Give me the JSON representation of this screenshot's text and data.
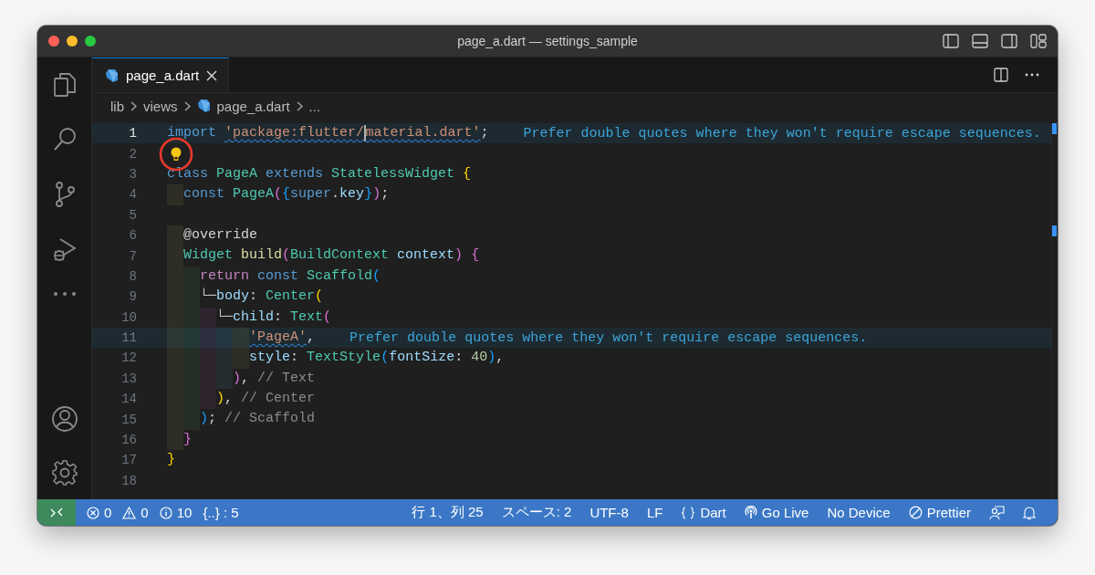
{
  "window": {
    "title": "page_a.dart — settings_sample"
  },
  "tabs": [
    {
      "label": "page_a.dart",
      "selected": true
    }
  ],
  "breadcrumbs": [
    {
      "label": "lib",
      "kind": "folder"
    },
    {
      "label": "views",
      "kind": "folder"
    },
    {
      "label": "page_a.dart",
      "kind": "file"
    },
    {
      "label": "...",
      "kind": "folder"
    }
  ],
  "editor": {
    "lines": [
      {
        "number": "1",
        "current": true,
        "diagnostic": "Prefer double quotes where they won't require escape sequences.",
        "tokens": [
          {
            "t": "import ",
            "color": "#569cd6"
          },
          {
            "t": "'package:flutter/",
            "color": "#ce9178",
            "squiggle": true,
            "cursor_after": true
          },
          {
            "t": "material.dart'",
            "color": "#ce9178",
            "squiggle": true
          },
          {
            "t": ";"
          }
        ]
      },
      {
        "number": "2",
        "current": false,
        "lightbulb": true
      },
      {
        "number": "3",
        "current": false,
        "tokens": [
          {
            "t": "class ",
            "color": "#569cd6"
          },
          {
            "t": "PageA ",
            "color": "#4ec9b0"
          },
          {
            "t": "extends ",
            "color": "#569cd6"
          },
          {
            "t": "StatelessWidget ",
            "color": "#4ec9b0"
          },
          {
            "t": "{",
            "color": "#ffd700"
          }
        ]
      },
      {
        "number": "4",
        "current": false,
        "tokens": [
          {
            "t": "  const ",
            "color": "#569cd6"
          },
          {
            "t": "PageA",
            "color": "#4ec9b0"
          },
          {
            "t": "(",
            "color": "#da70d6"
          },
          {
            "t": "{",
            "color": "#179fff"
          },
          {
            "t": "super",
            "color": "#569cd6"
          },
          {
            "t": "."
          },
          {
            "t": "key",
            "color": "#9cdcfe"
          },
          {
            "t": "}",
            "color": "#179fff"
          },
          {
            "t": ")",
            "color": "#da70d6"
          },
          {
            "t": ";",
            "color": "#d4d4d4"
          }
        ]
      },
      {
        "number": "5",
        "current": false
      },
      {
        "number": "6",
        "current": false,
        "tokens": [
          {
            "t": "  @override",
            "color": "#d4d4d4"
          }
        ]
      },
      {
        "number": "7",
        "current": false,
        "tokens": [
          {
            "t": "  Widget ",
            "color": "#4ec9b0"
          },
          {
            "t": "build",
            "color": "#dcdcaa"
          },
          {
            "t": "(",
            "color": "#da70d6"
          },
          {
            "t": "BuildContext ",
            "color": "#4ec9b0"
          },
          {
            "t": "context",
            "color": "#9cdcfe"
          },
          {
            "t": ") ",
            "color": "#da70d6"
          },
          {
            "t": "{",
            "color": "#da70d6"
          }
        ]
      },
      {
        "number": "8",
        "current": false,
        "tokens": [
          {
            "t": "    return ",
            "color": "#c586c0"
          },
          {
            "t": "const ",
            "color": "#569cd6"
          },
          {
            "t": "Scaffold",
            "color": "#4ec9b0"
          },
          {
            "t": "(",
            "color": "#179fff"
          }
        ]
      },
      {
        "number": "9",
        "current": false,
        "tokens": [
          {
            "t": "    └─",
            "color": "#c8c8c8"
          },
          {
            "t": "body",
            "color": "#9cdcfe"
          },
          {
            "t": ": ",
            "color": "#d4d4d4"
          },
          {
            "t": "Center",
            "color": "#4ec9b0"
          },
          {
            "t": "(",
            "color": "#ffd700"
          }
        ]
      },
      {
        "number": "10",
        "current": false,
        "tokens": [
          {
            "t": "      └─",
            "color": "#c8c8c8"
          },
          {
            "t": "child",
            "color": "#9cdcfe"
          },
          {
            "t": ": ",
            "color": "#d4d4d4"
          },
          {
            "t": "Text",
            "color": "#4ec9b0"
          },
          {
            "t": "(",
            "color": "#da70d6"
          }
        ]
      },
      {
        "number": "11",
        "current": false,
        "diagnostic": "Prefer double quotes where they won't require escape sequences.",
        "tokens": [
          {
            "t": "          'PageA'",
            "color": "#ce9178",
            "squiggle": true
          },
          {
            "t": ",",
            "color": "#d4d4d4"
          }
        ]
      },
      {
        "number": "12",
        "current": false,
        "tokens": [
          {
            "t": "          style",
            "color": "#9cdcfe"
          },
          {
            "t": ": ",
            "color": "#d4d4d4"
          },
          {
            "t": "TextStyle",
            "color": "#4ec9b0"
          },
          {
            "t": "(",
            "color": "#179fff"
          },
          {
            "t": "fontSize",
            "color": "#9cdcfe"
          },
          {
            "t": ": ",
            "color": "#d4d4d4"
          },
          {
            "t": "40",
            "color": "#b5cea8"
          },
          {
            "t": ")",
            "color": "#179fff"
          },
          {
            "t": ",",
            "color": "#d4d4d4"
          }
        ]
      },
      {
        "number": "13",
        "current": false,
        "tokens": [
          {
            "t": "        )",
            "color": "#da70d6"
          },
          {
            "t": ", ",
            "color": "#d4d4d4"
          },
          {
            "t": "// Text",
            "color": "#8b8b8b"
          }
        ]
      },
      {
        "number": "14",
        "current": false,
        "tokens": [
          {
            "t": "      )",
            "color": "#ffd700"
          },
          {
            "t": ", ",
            "color": "#d4d4d4"
          },
          {
            "t": "// Center",
            "color": "#8b8b8b"
          }
        ]
      },
      {
        "number": "15",
        "current": false,
        "tokens": [
          {
            "t": "    )",
            "color": "#179fff"
          },
          {
            "t": "; ",
            "color": "#d4d4d4"
          },
          {
            "t": "// Scaffold",
            "color": "#8b8b8b"
          }
        ]
      },
      {
        "number": "16",
        "current": false,
        "tokens": [
          {
            "t": "  }",
            "color": "#da70d6"
          }
        ]
      },
      {
        "number": "17",
        "current": false,
        "tokens": [
          {
            "t": "}",
            "color": "#ffd700"
          }
        ]
      },
      {
        "number": "18",
        "current": false
      }
    ]
  },
  "status_bar": {
    "left": [
      {
        "kind": "error",
        "text": "0"
      },
      {
        "kind": "warning",
        "text": "0"
      },
      {
        "kind": "info",
        "text": "10"
      },
      {
        "kind": "plain",
        "text": "{..} : 5"
      }
    ],
    "right": [
      {
        "kind": "plain",
        "text": "行 1、列 25"
      },
      {
        "kind": "plain",
        "text": "スペース: 2"
      },
      {
        "kind": "plain",
        "text": "UTF-8"
      },
      {
        "kind": "plain",
        "text": "LF"
      },
      {
        "kind": "braces",
        "text": "Dart"
      },
      {
        "kind": "broadcast",
        "text": "Go Live"
      },
      {
        "kind": "plain",
        "text": "No Device"
      },
      {
        "kind": "ban",
        "text": "Prettier"
      },
      {
        "kind": "feedback"
      },
      {
        "kind": "bell"
      }
    ]
  }
}
